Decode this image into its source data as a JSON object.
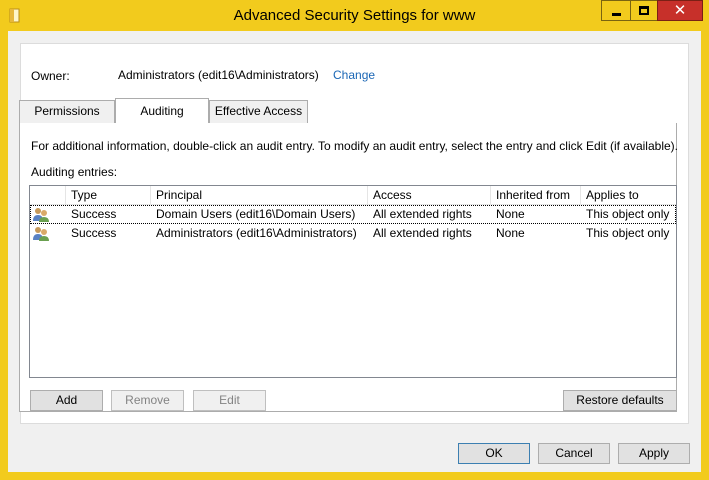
{
  "window": {
    "title": "Advanced Security Settings for www"
  },
  "owner": {
    "label": "Owner:",
    "value": "Administrators (edit16\\Administrators)",
    "change_link": "Change"
  },
  "tabs": [
    {
      "label": "Permissions",
      "active": false
    },
    {
      "label": "Auditing",
      "active": true
    },
    {
      "label": "Effective Access",
      "active": false
    }
  ],
  "auditing": {
    "info_text": "For additional information, double-click an audit entry. To modify an audit entry, select the entry and click Edit (if available).",
    "entries_label": "Auditing entries:",
    "columns": [
      "Type",
      "Principal",
      "Access",
      "Inherited from",
      "Applies to"
    ],
    "rows": [
      {
        "icon": "users-group-icon",
        "type": "Success",
        "principal": "Domain Users (edit16\\Domain Users)",
        "access": "All extended rights",
        "inherited_from": "None",
        "applies_to": "This object only"
      },
      {
        "icon": "users-group-icon",
        "type": "Success",
        "principal": "Administrators (edit16\\Administrators)",
        "access": "All extended rights",
        "inherited_from": "None",
        "applies_to": "This object only"
      }
    ],
    "buttons": {
      "add": "Add",
      "remove": "Remove",
      "edit": "Edit",
      "restore_defaults": "Restore defaults"
    }
  },
  "footer": {
    "ok": "OK",
    "cancel": "Cancel",
    "apply": "Apply"
  },
  "colors": {
    "titlebar": "#f2cb1d",
    "close_button": "#c7302a",
    "link": "#1a66b5"
  }
}
